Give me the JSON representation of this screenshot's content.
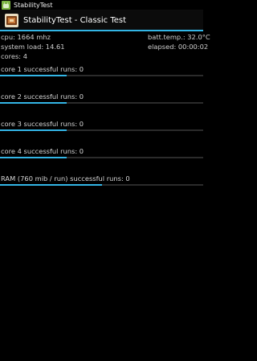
{
  "status_bar": {
    "app_name": "StabilityTest"
  },
  "action_bar": {
    "title": "StabilityTest - Classic Test"
  },
  "info": {
    "cpu": "cpu: 1664 mhz",
    "batt_temp": "batt.temp.: 32.0°C",
    "system_load": "system load: 14.61",
    "elapsed": "elapsed: 00:00:02",
    "cores": "cores: 4"
  },
  "tests": [
    {
      "label": "core 1 successful runs: 0",
      "progress": 0.33
    },
    {
      "label": "core 2 successful runs: 0",
      "progress": 0.33
    },
    {
      "label": "core 3 successful runs: 0",
      "progress": 0.33
    },
    {
      "label": "core 4 successful runs: 0",
      "progress": 0.33
    },
    {
      "label": "RAM (760 mib / run) successful runs: 0",
      "progress": 0.5
    }
  ],
  "colors": {
    "accent": "#33b5e5",
    "track": "#2b2b2b",
    "background": "#000000"
  },
  "icons": {
    "status_icon": "android-icon",
    "app_icon": "stability-test-app-icon"
  }
}
